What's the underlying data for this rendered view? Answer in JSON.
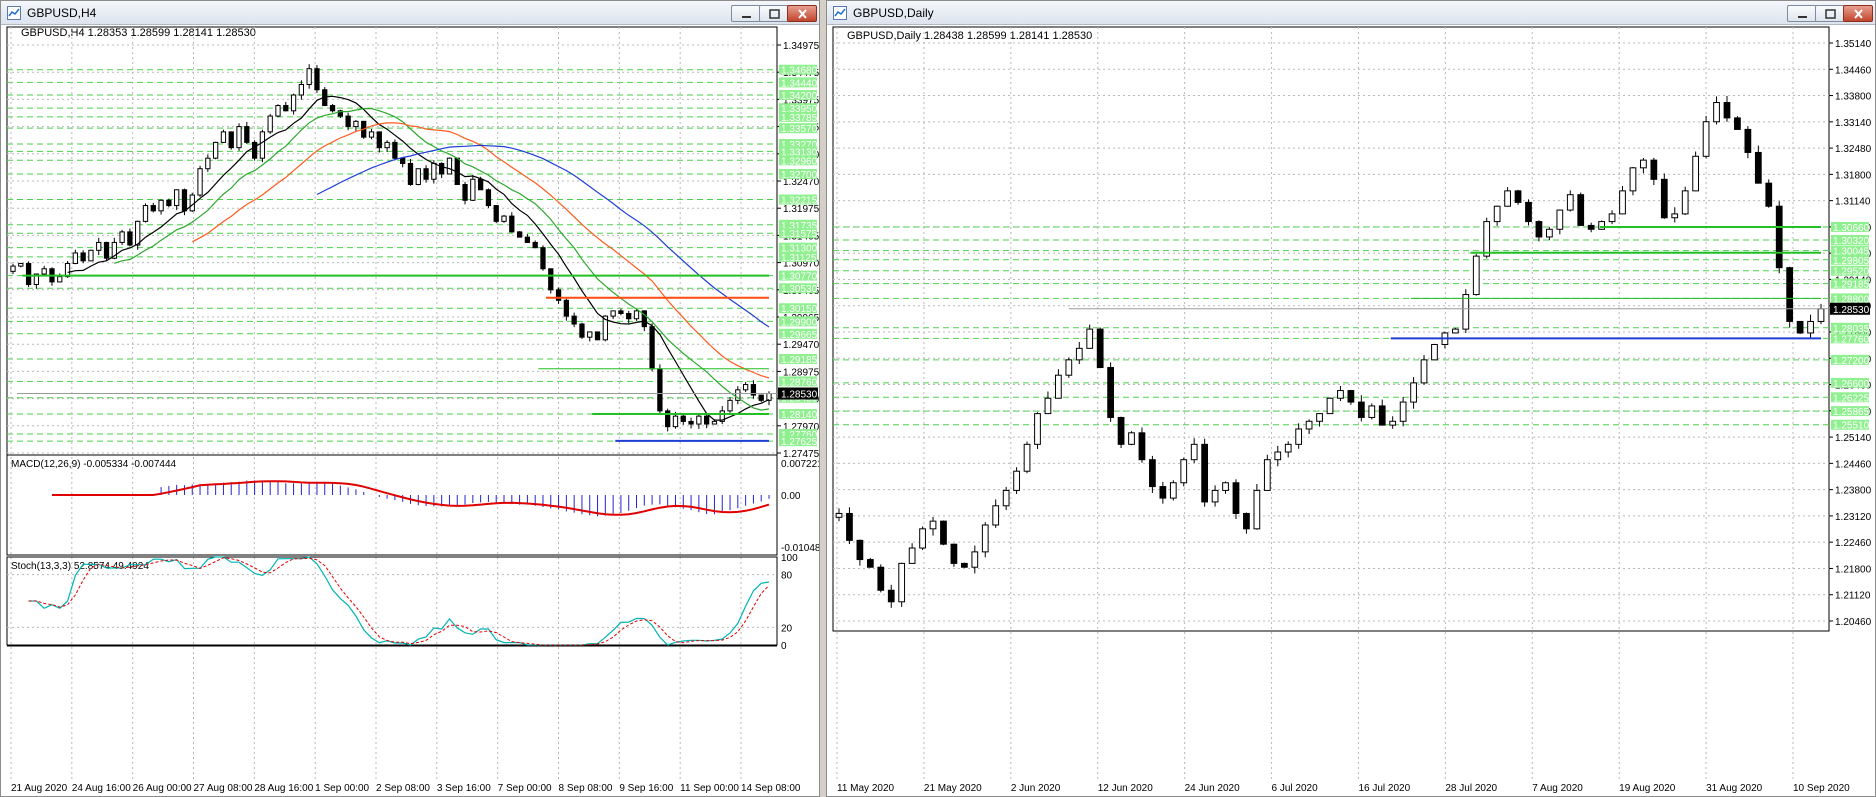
{
  "colors": {
    "grid": "#b9b9b9",
    "level": "#4bd24b",
    "sma_black": "#000000",
    "sma_green": "#2ca82c",
    "sma_orange": "#ff5a1e",
    "sma_blue": "#1f3ed6",
    "macd_hist": "#2323d2",
    "macd_signal": "#e00000",
    "stoch_main": "#00b4b4",
    "stoch_signal": "#e00000",
    "price_tag": "#000000",
    "label_bg": "#8ff08f"
  },
  "windows": [
    {
      "title": "GBPUSD,H4",
      "buttons": [
        "minimize-button",
        "restore-button",
        "close-button"
      ],
      "info": "GBPUSD,H4  1.28353 1.28599 1.28141 1.28530",
      "current_price": "1.28530",
      "chart_data": {
        "type": "candlestick",
        "symbol": "GBPUSD",
        "timeframe": "H4",
        "ylim": [
          1.274,
          1.3515
        ],
        "price_ticks": [
          "1.34975",
          "1.34475",
          "1.33975",
          "1.33475",
          "1.32980",
          "1.32470",
          "1.31975",
          "1.31465",
          "1.30970",
          "1.30465",
          "1.29965",
          "1.29470",
          "1.28975",
          "1.28470",
          "1.27970",
          "1.27475"
        ],
        "level_labels": [
          "1.34680",
          "1.34440",
          "1.34200",
          "1.33950",
          "1.33785",
          "1.33570",
          "1.33270",
          "1.33130",
          "1.32960",
          "1.32700",
          "1.32215",
          "1.31735",
          "1.31575",
          "1.31300",
          "1.31125",
          "1.30770",
          "1.30530",
          "1.30150",
          "1.29900",
          "1.29665",
          "1.29185",
          "1.28760",
          "1.28450",
          "1.28140",
          "1.27760",
          "1.27625"
        ],
        "time_labels": [
          "21 Aug 2020",
          "24 Aug 16:00",
          "26 Aug 00:00",
          "27 Aug 08:00",
          "28 Aug 16:00",
          "1 Sep 00:00",
          "2 Sep 08:00",
          "3 Sep 16:00",
          "7 Sep 00:00",
          "8 Sep 08:00",
          "9 Sep 16:00",
          "11 Sep 00:00",
          "14 Sep 08:00"
        ],
        "closes": [
          1.3095,
          1.31,
          1.306,
          1.308,
          1.309,
          1.3065,
          1.3075,
          1.31,
          1.312,
          1.3105,
          1.3125,
          1.314,
          1.311,
          1.314,
          1.316,
          1.3135,
          1.318,
          1.321,
          1.32,
          1.322,
          1.321,
          1.324,
          1.32,
          1.323,
          1.328,
          1.33,
          1.333,
          1.335,
          1.332,
          1.336,
          1.333,
          1.33,
          1.335,
          1.338,
          1.34,
          1.339,
          1.342,
          1.344,
          1.347,
          1.343,
          1.34,
          1.339,
          1.338,
          1.336,
          1.337,
          1.334,
          1.335,
          1.332,
          1.333,
          1.33,
          1.329,
          1.325,
          1.328,
          1.326,
          1.329,
          1.327,
          1.33,
          1.325,
          1.322,
          1.326,
          1.324,
          1.321,
          1.318,
          1.319,
          1.316,
          1.315,
          1.314,
          1.313,
          1.309,
          1.305,
          1.303,
          1.3,
          1.2985,
          1.296,
          1.297,
          1.2955,
          1.3,
          1.301,
          1.3005,
          1.2995,
          1.301,
          1.298,
          1.29,
          1.282,
          1.279,
          1.281,
          1.28,
          1.2795,
          1.281,
          1.2795,
          1.28,
          1.282,
          1.284,
          1.286,
          1.287,
          1.285,
          1.284,
          1.2853
        ],
        "horizontal_levels": [
          {
            "price": 1.3077,
            "color": "#22c022",
            "width": 2,
            "from": 0.02
          },
          {
            "price": 1.3035,
            "color": "#ff4a10",
            "width": 2,
            "from": 0.7
          },
          {
            "price": 1.29,
            "color": "#22c022",
            "width": 1,
            "from": 0.69
          },
          {
            "price": 1.2814,
            "color": "#22c022",
            "width": 2,
            "from": 0.76
          },
          {
            "price": 1.2763,
            "color": "#1f3ed6",
            "width": 2,
            "from": 0.79
          }
        ],
        "indicators": [
          {
            "name": "MACD(12,26,9)",
            "label": "MACD(12,26,9) -0.005334 -0.007444",
            "values": [
              "0.007221",
              "0.00",
              "-0.010488"
            ]
          },
          {
            "name": "Stoch(13,3,3)",
            "label": "Stoch(13,3,3) 52.8574 49.4924",
            "levels": [
              "100",
              "80",
              "20",
              "0"
            ]
          }
        ]
      }
    },
    {
      "title": "GBPUSD,Daily",
      "buttons": [
        "minimize-button",
        "restore-button",
        "close-button"
      ],
      "info": "GBPUSD,Daily  1.28438 1.28599 1.28141 1.28530",
      "current_price": "1.28530",
      "chart_data": {
        "type": "candlestick",
        "symbol": "GBPUSD",
        "timeframe": "Daily",
        "ylim": [
          1.204,
          1.3545
        ],
        "price_ticks": [
          "1.35140",
          "1.34460",
          "1.33800",
          "1.33140",
          "1.32480",
          "1.31800",
          "1.31140",
          "1.30460",
          "1.29800",
          "1.29140",
          "1.28460",
          "1.27800",
          "1.27140",
          "1.26460",
          "1.25800",
          "1.25140",
          "1.24460",
          "1.23800",
          "1.23120",
          "1.22460",
          "1.21800",
          "1.21120",
          "1.20460"
        ],
        "level_labels": [
          "1.30660",
          "1.30320",
          "1.30045",
          "1.29805",
          "1.29520",
          "1.29185",
          "1.28800",
          "1.28035",
          "1.27760",
          "1.27200",
          "1.26600",
          "1.26225",
          "1.25865",
          "1.25510"
        ],
        "time_labels": [
          "11 May 2020",
          "21 May 2020",
          "2 Jun 2020",
          "12 Jun 2020",
          "24 Jun 2020",
          "6 Jul 2020",
          "16 Jul 2020",
          "28 Jul 2020",
          "7 Aug 2020",
          "19 Aug 2020",
          "31 Aug 2020",
          "10 Sep 2020"
        ],
        "closes": [
          1.232,
          1.225,
          1.22,
          1.218,
          1.212,
          1.209,
          1.219,
          1.223,
          1.228,
          1.23,
          1.224,
          1.219,
          1.218,
          1.222,
          1.229,
          1.234,
          1.238,
          1.243,
          1.25,
          1.258,
          1.262,
          1.268,
          1.272,
          1.275,
          1.28,
          1.27,
          1.257,
          1.25,
          1.253,
          1.246,
          1.239,
          1.236,
          1.24,
          1.246,
          1.25,
          1.235,
          1.238,
          1.24,
          1.232,
          1.228,
          1.238,
          1.246,
          1.248,
          1.25,
          1.254,
          1.256,
          1.258,
          1.262,
          1.264,
          1.261,
          1.257,
          1.26,
          1.255,
          1.256,
          1.261,
          1.266,
          1.272,
          1.276,
          1.279,
          1.28,
          1.289,
          1.299,
          1.308,
          1.312,
          1.316,
          1.313,
          1.308,
          1.304,
          1.306,
          1.311,
          1.315,
          1.307,
          1.306,
          1.308,
          1.31,
          1.316,
          1.322,
          1.324,
          1.319,
          1.309,
          1.31,
          1.316,
          1.325,
          1.334,
          1.339,
          1.335,
          1.332,
          1.326,
          1.318,
          1.312,
          1.296,
          1.282,
          1.279,
          1.282,
          1.2853
        ],
        "horizontal_levels": [
          {
            "price": 1.3066,
            "color": "#22c022",
            "width": 2,
            "from": 0.77
          },
          {
            "price": 1.2999,
            "color": "#22c022",
            "width": 2,
            "from": 0.64
          },
          {
            "price": 1.288,
            "color": "#22c022",
            "width": 1,
            "from": 0.58
          },
          {
            "price": 1.2776,
            "color": "#1f3ed6",
            "width": 2,
            "from": 0.56
          }
        ]
      }
    }
  ]
}
